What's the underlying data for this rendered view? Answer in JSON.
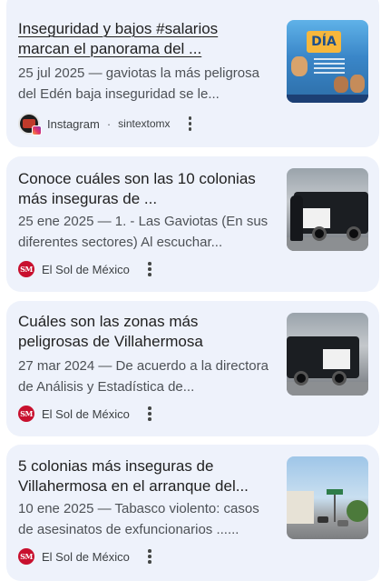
{
  "results": [
    {
      "title": "Inseguridad y bajos #salarios marcan el panorama del ...",
      "snippet": "25 jul 2025 — gaviotas la más peligrosa del Edén baja inseguridad se le...",
      "source": "Instagram",
      "separator": "·",
      "handle": "sintextomx",
      "logo": "instagram-profile-icon",
      "thumb_text": "DÍA"
    },
    {
      "title": "Conoce cuáles son las 10 colonias más inseguras de ...",
      "snippet": "25 ene 2025 — 1. - Las Gaviotas (En sus diferentes sectores) Al escuchar...",
      "source": "El Sol de México",
      "logo": "el-sol-de-mexico-icon",
      "logo_text": "SM"
    },
    {
      "title": "Cuáles son las zonas más peligrosas de Villahermosa",
      "snippet": "27 mar 2024 — De acuerdo a la directora de Análisis y Estadística de...",
      "source": "El Sol de México",
      "logo": "el-sol-de-mexico-icon",
      "logo_text": "SM"
    },
    {
      "title": "5 colonias más inseguras de Villahermosa en el arranque del...",
      "snippet": "10 ene 2025 — Tabasco violento: casos de asesinatos de exfuncionarios ......",
      "source": "El Sol de México",
      "logo": "el-sol-de-mexico-icon",
      "logo_text": "SM"
    }
  ]
}
